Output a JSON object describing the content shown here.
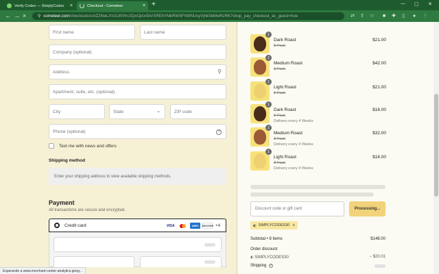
{
  "browser": {
    "tabs": [
      {
        "title": "Verify Codes — SimplyCodes",
        "active": false
      },
      {
        "title": "Checkout - Cometeer",
        "active": true
      }
    ],
    "new_tab": "+",
    "window_controls": [
      "—",
      "▢",
      "✕"
    ],
    "url_host": "cometeer.com",
    "url_path": "/checkouts/cn/Z2NwLXVzLWVhc3QxOjAxSkVXREhYMkRWSFhWNUsyVjhkSkMwRzRK?shop_pay_checkout_as_guest=true",
    "status_text": "Esperando a www.merchant-center-analytics.goog..."
  },
  "checkout": {
    "first_name_placeholder": "First name",
    "last_name_placeholder": "Last name",
    "company_placeholder": "Company (optional)",
    "address_placeholder": "Address",
    "apartment_placeholder": "Apartment, suite, etc. (optional)",
    "city_placeholder": "City",
    "state_placeholder": "State",
    "zip_placeholder": "ZIP code",
    "phone_placeholder": "Phone (optional)",
    "news_label": "Text me with news and offers",
    "shipping_title": "Shipping method",
    "shipping_note": "Enter your shipping address to view available shipping methods.",
    "payment_title": "Payment",
    "payment_sub": "All transactions are secure and encrypted.",
    "credit_card_label": "Credit card",
    "card_brands": [
      "VISA",
      "MC",
      "AMEX",
      "DISCOVER"
    ],
    "more_cards": "+4"
  },
  "order": {
    "items": [
      {
        "name": "Dark Roast",
        "pack": "8-Pack",
        "delivery": "",
        "price": "$21.00",
        "qty": "1",
        "color": "#4a2c1a",
        "faded": false
      },
      {
        "name": "Medium Roast",
        "pack": "8-Pack",
        "delivery": "",
        "price": "$42.00",
        "qty": "2",
        "color": "#9a5a35",
        "faded": false
      },
      {
        "name": "Light Roast",
        "pack": "8-Pack",
        "delivery": "",
        "price": "$21.00",
        "qty": "1",
        "color": "#e8c46a",
        "faded": true
      },
      {
        "name": "Dark Roast",
        "pack": "8-Pack",
        "delivery": "Delivery every 4 Weeks",
        "price": "$16.00",
        "qty": "1",
        "color": "#4a2c1a",
        "faded": false
      },
      {
        "name": "Medium Roast",
        "pack": "8-Pack",
        "delivery": "Delivery every 4 Weeks",
        "price": "$32.00",
        "qty": "2",
        "color": "#9a5a35",
        "faded": false
      },
      {
        "name": "Light Roast",
        "pack": "8-Pack",
        "delivery": "Delivery every 4 Weeks",
        "price": "$16.00",
        "qty": "1",
        "color": "#e8c46a",
        "faded": true
      }
    ],
    "discount_placeholder": "Discount code or gift card",
    "apply_label": "Processing...",
    "applied_code": "SIMPLYCODES30",
    "subtotal_label": "Subtotal • 8 items",
    "subtotal_value": "$148.00",
    "order_discount_label": "Order discount",
    "discount_code_label": "SIMPLYCODES30",
    "discount_value": "− $20.01",
    "shipping_label": "Shipping"
  }
}
